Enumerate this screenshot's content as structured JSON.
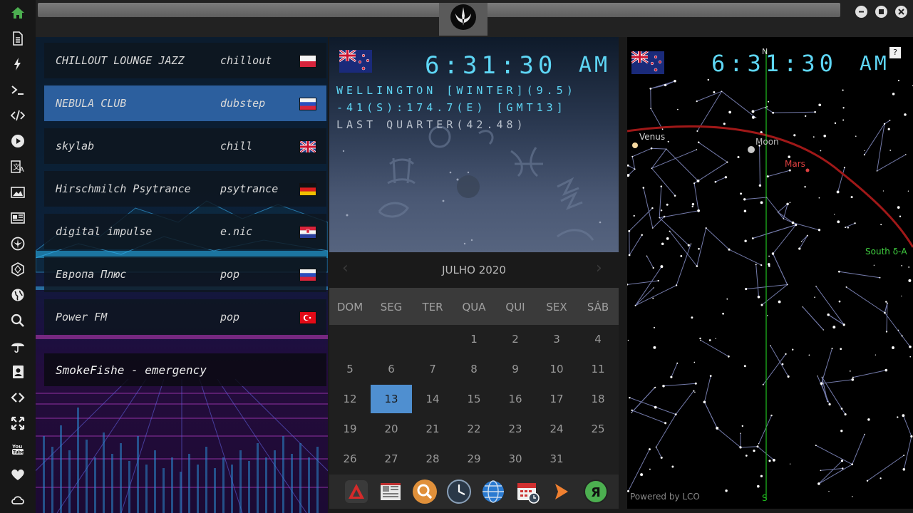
{
  "sidebar": {
    "items": [
      {
        "icon": "home-icon"
      },
      {
        "icon": "document-icon"
      },
      {
        "icon": "lightning-icon"
      },
      {
        "icon": "terminal-icon"
      },
      {
        "icon": "code-icon"
      },
      {
        "icon": "play-icon"
      },
      {
        "icon": "translate-icon"
      },
      {
        "icon": "image-icon"
      },
      {
        "icon": "news-icon"
      },
      {
        "icon": "rebel-icon"
      },
      {
        "icon": "hexagon-icon"
      },
      {
        "icon": "globe-icon"
      },
      {
        "icon": "search-icon"
      },
      {
        "icon": "umbrella-icon"
      },
      {
        "icon": "contact-icon"
      },
      {
        "icon": "link-icon"
      },
      {
        "icon": "fullscreen-icon"
      },
      {
        "icon": "youtube-icon"
      },
      {
        "icon": "heart-icon"
      },
      {
        "icon": "cloud-icon"
      }
    ],
    "accent": "#4caf50"
  },
  "radio": {
    "stations": [
      {
        "name": "CHILLOUT LOUNGE JAZZ",
        "genre": "chillout",
        "flag": "pl"
      },
      {
        "name": "NEBULA CLUB",
        "genre": "dubstep",
        "flag": "ru",
        "selected": true
      },
      {
        "name": "skylab",
        "genre": "chill",
        "flag": "uk"
      },
      {
        "name": "Hirschmilch Psytrance",
        "genre": "psytrance",
        "flag": "de"
      },
      {
        "name": "digital impulse",
        "genre": "e.nic",
        "flag": "hr"
      },
      {
        "name": "Европа Плюс",
        "genre": "pop",
        "flag": "ru"
      },
      {
        "name": "Power FM",
        "genre": "pop",
        "flag": "tr"
      }
    ],
    "now_playing": "SmokeFishe - emergency"
  },
  "clock": {
    "time": "6:31:30",
    "ampm": "AM",
    "line1": "WELLINGTON [WINTER](9.5)",
    "line2": "-41(S):174.7(E) [GMT13]",
    "line3": "LAST QUARTER(42.48)"
  },
  "calendar": {
    "month_label": "JULHO 2020",
    "prev": "‹",
    "next": "›",
    "day_names": [
      "DOM",
      "SEG",
      "TER",
      "QUA",
      "QUI",
      "SEX",
      "SÁB"
    ],
    "weeks": [
      [
        "",
        "",
        "",
        "1",
        "2",
        "3",
        "4"
      ],
      [
        "5",
        "6",
        "7",
        "8",
        "9",
        "10",
        "11"
      ],
      [
        "12",
        "13",
        "14",
        "15",
        "16",
        "17",
        "18"
      ],
      [
        "19",
        "20",
        "21",
        "22",
        "23",
        "24",
        "25"
      ],
      [
        "26",
        "27",
        "28",
        "29",
        "30",
        "31",
        ""
      ]
    ],
    "today": "13"
  },
  "dock": {
    "apps": [
      "anydesk-icon",
      "news-app-icon",
      "search-app-icon",
      "clock-app-icon",
      "globe-app-icon",
      "calendar-app-icon",
      "arrow-app-icon",
      "yandex-icon"
    ]
  },
  "skymap": {
    "time": "6:31:30",
    "ampm": "AM",
    "help": "?",
    "north": "N",
    "south": "S",
    "labels": {
      "venus": "Venus",
      "moon": "Moon",
      "mars": "Mars",
      "southdelta": "South δ-A"
    },
    "powered": "Powered by LCO"
  }
}
